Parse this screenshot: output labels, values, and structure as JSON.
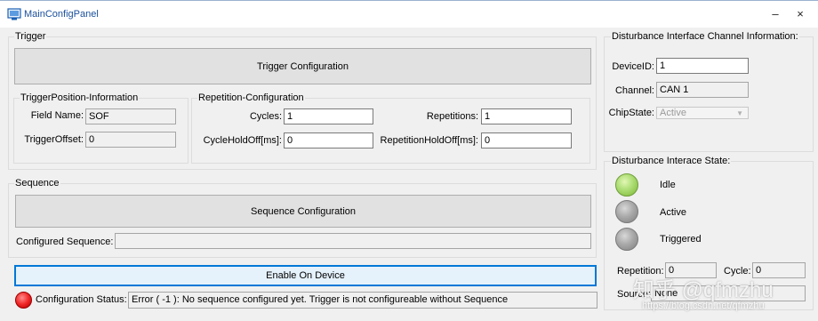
{
  "window": {
    "title": "MainConfigPanel",
    "minimize_glyph": "–",
    "close_glyph": "×"
  },
  "trigger": {
    "legend": "Trigger",
    "config_button": "Trigger Configuration",
    "position_info": {
      "legend": "TriggerPosition-Information",
      "field_name_label": "Field Name:",
      "field_name_value": "SOF",
      "trigger_offset_label": "TriggerOffset:",
      "trigger_offset_value": "0"
    },
    "repetition": {
      "legend": "Repetition-Configuration",
      "cycles_label": "Cycles:",
      "cycles_value": "1",
      "repetitions_label": "Repetitions:",
      "repetitions_value": "1",
      "cycle_holdoff_label": "CycleHoldOff[ms]:",
      "cycle_holdoff_value": "0",
      "repetition_holdoff_label": "RepetitionHoldOff[ms]:",
      "repetition_holdoff_value": "0"
    }
  },
  "sequence": {
    "legend": "Sequence",
    "config_button": "Sequence Configuration",
    "configured_label": "Configured Sequence:",
    "configured_value": ""
  },
  "enable_button": "Enable On Device",
  "config_status": {
    "label": "Configuration Status:",
    "value": "Error ( -1 ): No sequence configured yet. Trigger is not configureable without Sequence",
    "indicator_color": "#f02727"
  },
  "channel_info": {
    "legend": "Disturbance Interface Channel Information:",
    "device_id_label": "DeviceID:",
    "device_id_value": "1",
    "channel_label": "Channel:",
    "channel_value": "CAN 1",
    "chip_state_label": "ChipState:",
    "chip_state_value": "Active"
  },
  "interface_state": {
    "legend": "Disturbance Interace State:",
    "states": [
      {
        "label": "Idle",
        "color": "#9fd65c"
      },
      {
        "label": "Active",
        "color": "#a9a9a9"
      },
      {
        "label": "Triggered",
        "color": "#a9a9a9"
      }
    ],
    "repetition_label": "Repetition:",
    "repetition_value": "0",
    "cycle_label": "Cycle:",
    "cycle_value": "0",
    "source_label": "Source:",
    "source_value": "None"
  },
  "watermark": {
    "brand": "知乎 @qfmzhu",
    "url": "https://blog.csdn.net/qfmzhu"
  }
}
